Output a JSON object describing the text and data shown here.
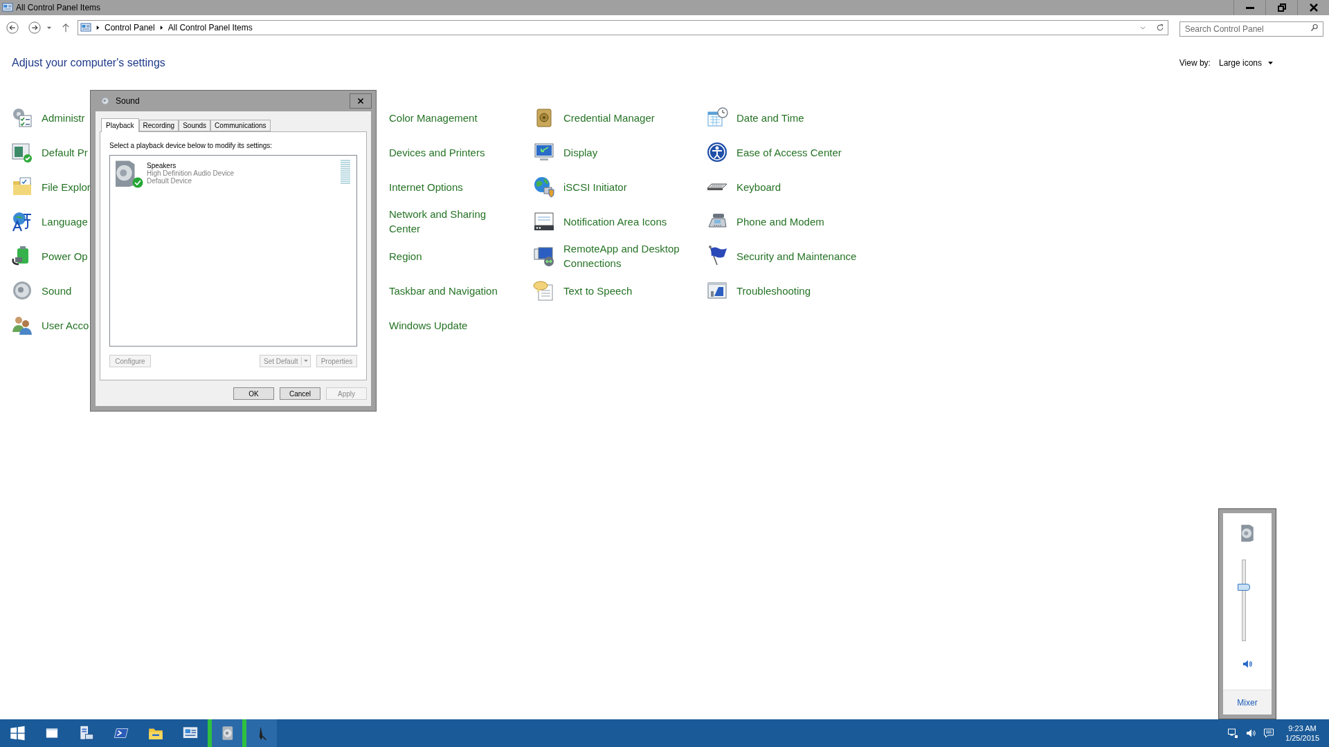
{
  "window": {
    "title": "All Control Panel Items"
  },
  "address_bar": {
    "path": [
      "Control Panel",
      "All Control Panel Items"
    ]
  },
  "search": {
    "placeholder": "Search Control Panel"
  },
  "heading": "Adjust your computer's settings",
  "view_by": {
    "label": "View by:",
    "value": "Large icons"
  },
  "columns": [
    {
      "items": [
        {
          "label": "Administr"
        },
        {
          "label": "Default Pr"
        },
        {
          "label": "File Explor"
        },
        {
          "label": "Language"
        },
        {
          "label": "Power Op"
        },
        {
          "label": "Sound"
        },
        {
          "label": "User Acco"
        }
      ]
    },
    {
      "items": [
        {
          "label": "Color Management"
        },
        {
          "label": "Devices and Printers"
        },
        {
          "label": "Internet Options"
        },
        {
          "label": "Network and Sharing Center"
        },
        {
          "label": "Region"
        },
        {
          "label": "Taskbar and Navigation"
        },
        {
          "label": "Windows Update"
        }
      ]
    },
    {
      "items": [
        {
          "label": "Credential Manager"
        },
        {
          "label": "Display"
        },
        {
          "label": "iSCSI Initiator"
        },
        {
          "label": "Notification Area Icons"
        },
        {
          "label": "RemoteApp and Desktop Connections"
        },
        {
          "label": "Text to Speech"
        }
      ]
    },
    {
      "items": [
        {
          "label": "Date and Time"
        },
        {
          "label": "Ease of Access Center"
        },
        {
          "label": "Keyboard"
        },
        {
          "label": "Phone and Modem"
        },
        {
          "label": "Security and Maintenance"
        },
        {
          "label": "Troubleshooting"
        }
      ]
    }
  ],
  "dialog": {
    "title": "Sound",
    "tabs": [
      {
        "label": "Playback",
        "selected": true
      },
      {
        "label": "Recording",
        "selected": false
      },
      {
        "label": "Sounds",
        "selected": false
      },
      {
        "label": "Communications",
        "selected": false
      }
    ],
    "instruction": "Select a playback device below to modify its settings:",
    "devices": [
      {
        "name": "Speakers",
        "description": "High Definition Audio Device",
        "status": "Default Device",
        "default": true,
        "level": 0
      }
    ],
    "device_buttons": [
      {
        "label": "Configure",
        "disabled": true
      },
      {
        "label": "Set Default",
        "disabled": true,
        "kind": "split"
      },
      {
        "label": "Properties",
        "disabled": true
      }
    ],
    "buttons": [
      {
        "label": "OK",
        "disabled": false
      },
      {
        "label": "Cancel",
        "disabled": false
      },
      {
        "label": "Apply",
        "disabled": true
      }
    ]
  },
  "volume_flyout": {
    "level": 0.66,
    "link": "Mixer"
  },
  "taskbar": {
    "buttons": [
      {
        "kind": "start",
        "highlighted": false
      },
      {
        "kind": "windows",
        "highlighted": false
      },
      {
        "kind": "server",
        "highlighted": false
      },
      {
        "kind": "terminal",
        "highlighted": false
      },
      {
        "kind": "folder",
        "highlighted": false
      },
      {
        "kind": "control-panel",
        "highlighted": false
      },
      {
        "kind": "speaker",
        "highlighted": true
      },
      {
        "kind": "pen",
        "highlighted": true
      }
    ],
    "clock": {
      "time": "9:23 AM",
      "date": "1/25/2015"
    }
  }
}
